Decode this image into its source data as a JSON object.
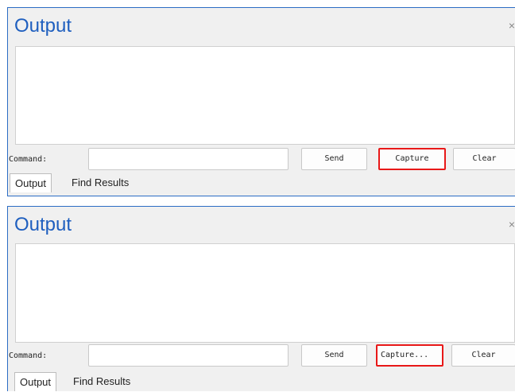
{
  "panels": [
    {
      "title": "Output",
      "close_glyph": "×",
      "command_label": "Command:",
      "command_value": "",
      "buttons": {
        "send": "Send",
        "capture": "Capture",
        "clear": "Clear"
      },
      "tabs": [
        "Output",
        "Find Results"
      ],
      "highlight_color": "#e81818"
    },
    {
      "title": "Output",
      "close_glyph": "×",
      "command_label": "Command:",
      "command_value": "",
      "buttons": {
        "send": "Send",
        "capture": "Capture...",
        "clear": "Clear"
      },
      "tabs": [
        "Output",
        "Find Results"
      ],
      "highlight_color": "#e81818"
    }
  ],
  "colors": {
    "title": "#1f5fbf",
    "panel_border": "#2b6cc4",
    "panel_background": "#f0f0f0"
  }
}
